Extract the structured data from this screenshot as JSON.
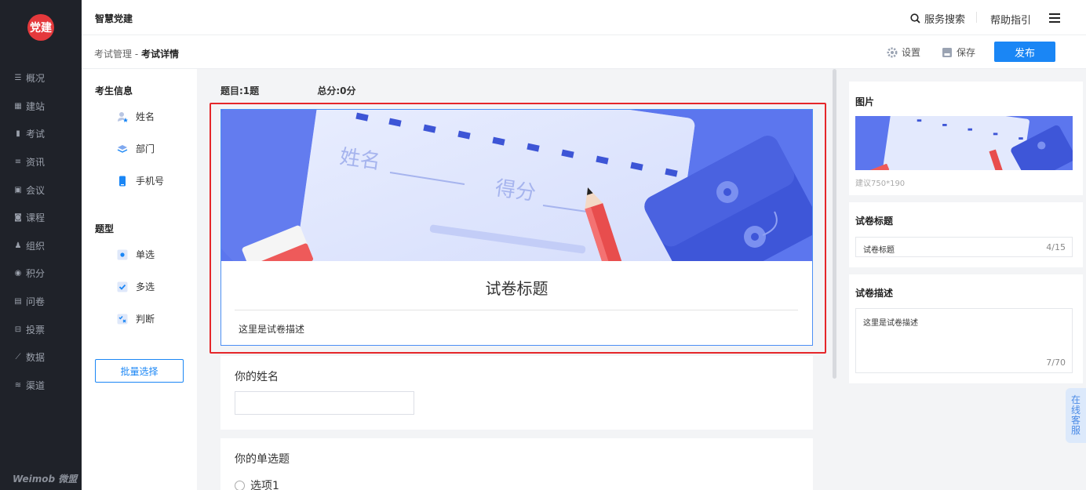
{
  "app": {
    "logo_text": "党建",
    "title": "智慧党建",
    "brand": "Weimob 微盟"
  },
  "sidebar": {
    "items": [
      {
        "label": "概况",
        "icon": "overview-icon"
      },
      {
        "label": "建站",
        "icon": "site-icon"
      },
      {
        "label": "考试",
        "icon": "exam-icon"
      },
      {
        "label": "资讯",
        "icon": "news-icon"
      },
      {
        "label": "会议",
        "icon": "meeting-icon"
      },
      {
        "label": "课程",
        "icon": "course-icon"
      },
      {
        "label": "组织",
        "icon": "organization-icon"
      },
      {
        "label": "积分",
        "icon": "points-icon"
      },
      {
        "label": "问卷",
        "icon": "questionnaire-icon"
      },
      {
        "label": "投票",
        "icon": "vote-icon"
      },
      {
        "label": "数据",
        "icon": "data-icon"
      },
      {
        "label": "渠道",
        "icon": "channel-icon"
      }
    ]
  },
  "topbar": {
    "search_label": "服务搜索",
    "help_label": "帮助指引"
  },
  "subbar": {
    "breadcrumb_parent": "考试管理",
    "breadcrumb_sep": " - ",
    "breadcrumb_current": "考试详情",
    "settings_label": "设置",
    "save_label": "保存",
    "publish_label": "发布"
  },
  "components": {
    "candidate_title": "考生信息",
    "candidate_items": [
      "姓名",
      "部门",
      "手机号"
    ],
    "type_title": "题型",
    "type_items": [
      "单选",
      "多选",
      "判断"
    ],
    "batch_label": "批量选择"
  },
  "canvas": {
    "question_count": "题目:1题",
    "total_score": "总分:0分",
    "banner_text_1": "姓名",
    "banner_text_2": "得分",
    "paper_title": "试卷标题",
    "paper_desc": "这里是试卷描述",
    "q1_title": "你的姓名",
    "q2_title": "你的单选题",
    "q2_option": "选项1"
  },
  "right_panel": {
    "image_title": "图片",
    "image_hint": "建议750*190",
    "title_label": "试卷标题",
    "title_value": "试卷标题",
    "title_count": "4/15",
    "desc_label": "试卷描述",
    "desc_value": "这里是试卷描述",
    "desc_count": "7/70"
  },
  "online_service": "在线客服",
  "colors": {
    "primary": "#1a86f5",
    "sidebar_bg": "#1f2229",
    "highlight": "#e5262a",
    "banner_bg": "#5c76ee"
  }
}
